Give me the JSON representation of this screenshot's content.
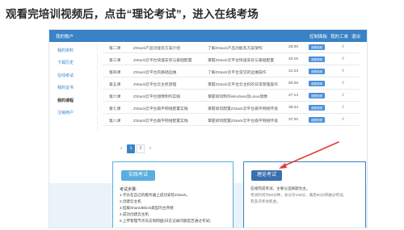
{
  "caption": "观看完培训视频后，点击“理论考试”，进入在线考场",
  "topbar": {
    "account": "我的账户",
    "nav": [
      "控制面板",
      "我的工单",
      "退出"
    ]
  },
  "sidebar": {
    "items": [
      {
        "label": "我的资料",
        "active": false
      },
      {
        "label": "下载历史",
        "active": false
      },
      {
        "label": "在线考试",
        "active": false
      },
      {
        "label": "我的证书",
        "active": false
      },
      {
        "label": "我的课程",
        "active": true
      },
      {
        "label": "注销用户",
        "active": false
      }
    ]
  },
  "course_table": {
    "button_label": "观看视频",
    "rows": [
      {
        "num": "第二课",
        "title": "ZStack产品功能及方案介绍",
        "desc": "了解ZStack产品功能及方案架构",
        "duration": "28:00",
        "check": "√"
      },
      {
        "num": "第三课",
        "title": "ZStack云平台快速安装与基础配置",
        "desc": "掌握ZStack云平台快速安装与基础配置",
        "duration": "43:15",
        "check": "√"
      },
      {
        "num": "第四课",
        "title": "ZStack云平台的基础运维",
        "desc": "了解ZStack云平台常见的运维操作",
        "duration": "31:23",
        "check": "√"
      },
      {
        "num": "第五课",
        "title": "ZStack云平台云主机管理",
        "desc": "掌握ZStack云平台云主机的日常管理操作",
        "duration": "50:26",
        "check": "√"
      },
      {
        "num": "第六课",
        "title": "ZStack云平台镜像制作实践",
        "desc": "掌握如何制作Windows及Linux镜像",
        "duration": "47:14",
        "check": "√"
      },
      {
        "num": "第七课",
        "title": "ZStack云平台扁平网络配置实践",
        "desc": "掌握如何配置ZStack云平台扁平网络环境",
        "duration": "38:34",
        "check": "√"
      },
      {
        "num": "第八课",
        "title": "ZStack云平台扁平网络配置实践",
        "desc": "掌握如何配置ZStack云平台扁平网络环境",
        "duration": "37:20",
        "check": "√"
      }
    ]
  },
  "pagination": {
    "prev": "«",
    "pages": [
      "1",
      "2"
    ],
    "current": "1",
    "next": "»"
  },
  "practice_exam": {
    "button": "实践考试",
    "title": "考试步骤:",
    "steps": [
      "1.学员在自己的服务器上成功安装ZStack。",
      "2.创建云主机",
      "3.挂载SharedBlock类型的主存储",
      "4.成功创建云主机",
      "5.上传管理节点日志到网盘(日志记录问题是否通过考试)"
    ]
  },
  "theory_exam": {
    "button": "理论考试",
    "lines": [
      "在线完成考试，主要以选择题为主。",
      "考试时间为60分钟，总分为100分，满足80分即通过考试。",
      "有多次考试机会。"
    ]
  },
  "colors": {
    "primary": "#3a82c6",
    "button_blue": "#4a90d9",
    "panel_border": "#5aaede",
    "footer_bg": "#e9f3f9",
    "arrow_red": "#e53935"
  }
}
